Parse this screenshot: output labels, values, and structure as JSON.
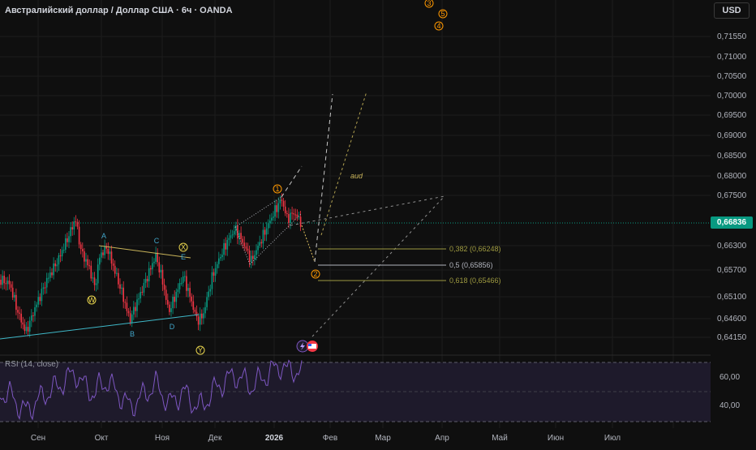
{
  "header": {
    "title": "Австралийский доллар / Доллар США · 6ч · OANDA",
    "currency": "USD"
  },
  "price_scale": {
    "labels": [
      "0,71550",
      "0,71000",
      "0,70500",
      "0,70000",
      "0,69500",
      "0,69000",
      "0,68500",
      "0,68000",
      "0,67500",
      "0,66300",
      "0,65700",
      "0,65100",
      "0,64600",
      "0,64150"
    ],
    "current_price": "0,66836",
    "current_price_color": "#089981"
  },
  "rsi": {
    "legend": "RSI (14, close)",
    "labels": [
      "60,00",
      "40,00"
    ],
    "line_color": "#7e57c2"
  },
  "time_axis": {
    "labels": [
      "Сен",
      "Окт",
      "Ноя",
      "Дек",
      "2026",
      "Фев",
      "Мар",
      "Апр",
      "Май",
      "Июн",
      "Июл"
    ]
  },
  "waves": {
    "projection_labels": [
      "3",
      "5",
      "4"
    ],
    "impulse_labels": [
      "1",
      "2"
    ],
    "correction_labels": [
      "W",
      "X",
      "Y"
    ],
    "abcde_labels": [
      "A",
      "B",
      "C",
      "D",
      "E"
    ]
  },
  "fibonacci": [
    {
      "label": "0,382 (0,66248)",
      "color": "#9e9a40"
    },
    {
      "label": "0,5 (0,65856)",
      "color": "#b2b5be"
    },
    {
      "label": "0,618 (0,65466)",
      "color": "#9e9a40"
    }
  ],
  "annotations": {
    "text_note": "aud"
  },
  "colors": {
    "up": "#089981",
    "down": "#f23645",
    "wave_orange": "#ff9800",
    "wave_yellow": "#e8d44d",
    "abcde_blue": "#42a5c8"
  }
}
